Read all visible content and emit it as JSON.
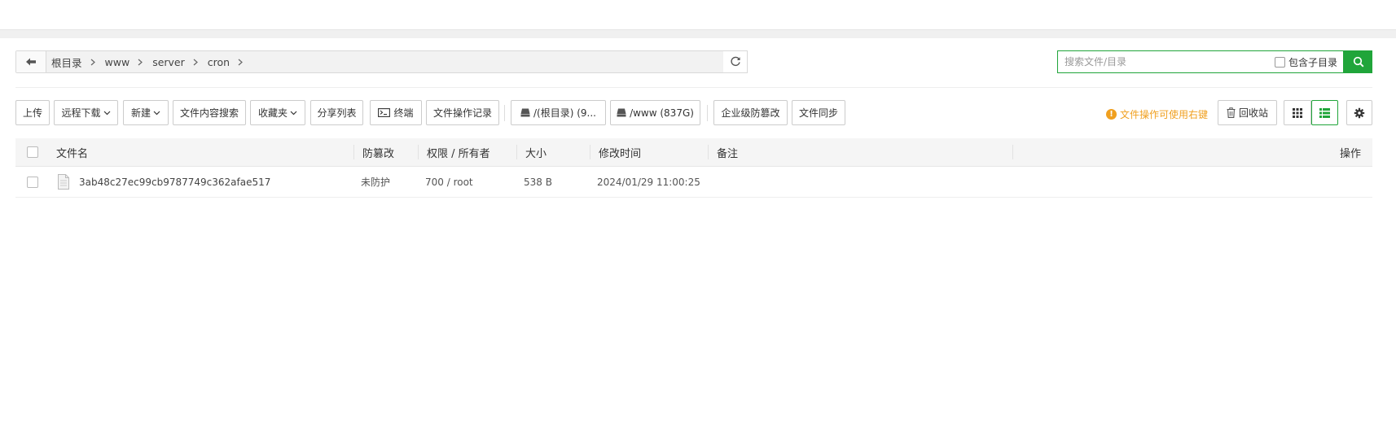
{
  "path": {
    "crumbs": [
      "根目录",
      "www",
      "server",
      "cron"
    ]
  },
  "search": {
    "placeholder": "搜索文件/目录",
    "subdir_label": "包含子目录"
  },
  "toolbar": {
    "upload": "上传",
    "remote_download": "远程下载",
    "new": "新建",
    "content_search": "文件内容搜索",
    "favorites": "收藏夹",
    "share_list": "分享列表",
    "terminal": "终端",
    "file_log": "文件操作记录",
    "disk_root": "/(根目录) (9...",
    "disk_www": "/www (837G)",
    "tamper_proof": "企业级防篡改",
    "file_sync": "文件同步",
    "tip": "文件操作可使用右键",
    "recycle": "回收站"
  },
  "table": {
    "headers": {
      "name": "文件名",
      "protect": "防篡改",
      "perm": "权限 / 所有者",
      "size": "大小",
      "mtime": "修改时间",
      "note": "备注",
      "ops": "操作"
    },
    "rows": [
      {
        "name": "3ab48c27ec99cb9787749c362afae517",
        "protect": "未防护",
        "perm": "700 / root",
        "size": "538 B",
        "mtime": "2024/01/29 11:00:25",
        "note": ""
      }
    ]
  },
  "colors": {
    "accent": "#20a53a",
    "tip": "#f0a020"
  }
}
